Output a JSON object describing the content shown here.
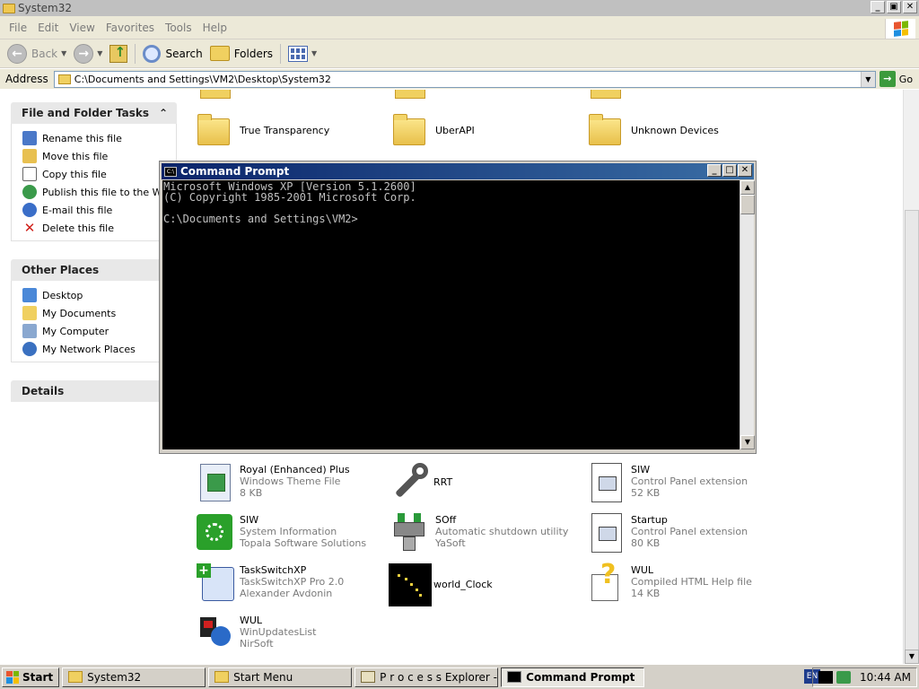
{
  "window": {
    "title": "System32",
    "buttons": {
      "minimize": "_",
      "maximize": "▣",
      "close": "✕"
    }
  },
  "menu": [
    "File",
    "Edit",
    "View",
    "Favorites",
    "Tools",
    "Help"
  ],
  "toolbar": {
    "back_label": "Back",
    "search_label": "Search",
    "folders_label": "Folders"
  },
  "address": {
    "label": "Address",
    "value": "C:\\Documents and Settings\\VM2\\Desktop\\System32",
    "go_label": "Go"
  },
  "left_pane": {
    "file_tasks": {
      "title": "File and Folder Tasks",
      "items": [
        {
          "label": "Rename this file",
          "icon": "rename-icon"
        },
        {
          "label": "Move this file",
          "icon": "move-icon"
        },
        {
          "label": "Copy this file",
          "icon": "copy-icon"
        },
        {
          "label": "Publish this file to the Web",
          "icon": "publish-icon"
        },
        {
          "label": "E-mail this file",
          "icon": "email-icon"
        },
        {
          "label": "Delete this file",
          "icon": "delete-icon"
        }
      ]
    },
    "other_places": {
      "title": "Other Places",
      "items": [
        {
          "label": "Desktop",
          "icon": "desktop-icon"
        },
        {
          "label": "My Documents",
          "icon": "documents-icon"
        },
        {
          "label": "My Computer",
          "icon": "computer-icon"
        },
        {
          "label": "My Network Places",
          "icon": "network-icon"
        }
      ]
    },
    "details": {
      "title": "Details"
    }
  },
  "files_top": [
    {
      "name": "True Transparency",
      "icon": "folder-icon"
    },
    {
      "name": "UberAPI",
      "icon": "folder-icon"
    },
    {
      "name": "Unknown Devices",
      "icon": "folder-icon"
    }
  ],
  "files": [
    {
      "name": "Royal (Enhanced) Plus",
      "line2": "Windows Theme File",
      "line3": "8 KB",
      "icon": "theme-file-icon"
    },
    {
      "name": "RRT",
      "line2": "",
      "line3": "",
      "icon": "wrench-icon"
    },
    {
      "name": "SIW",
      "line2": "Control Panel extension",
      "line3": "52 KB",
      "icon": "control-panel-icon"
    },
    {
      "name": "SIW",
      "line2": "System Information",
      "line3": "Topala Software Solutions",
      "icon": "siw-icon"
    },
    {
      "name": "SOff",
      "line2": "Automatic shutdown utility",
      "line3": "YaSoft",
      "icon": "plug-icon"
    },
    {
      "name": "Startup",
      "line2": "Control Panel extension",
      "line3": "80 KB",
      "icon": "control-panel-icon"
    },
    {
      "name": "TaskSwitchXP",
      "line2": "TaskSwitchXP Pro 2.0",
      "line3": "Alexander Avdonin",
      "icon": "taskswitch-icon"
    },
    {
      "name": "world_Clock",
      "line2": "",
      "line3": "",
      "icon": "world-clock-icon"
    },
    {
      "name": "WUL",
      "line2": "Compiled HTML Help file",
      "line3": "14 KB",
      "icon": "help-file-icon"
    },
    {
      "name": "WUL",
      "line2": "WinUpdatesList",
      "line3": "NirSoft",
      "icon": "wul-icon"
    }
  ],
  "cmd": {
    "title": "Command Prompt",
    "lines": [
      "Microsoft Windows XP [Version 5.1.2600]",
      "(C) Copyright 1985-2001 Microsoft Corp.",
      "",
      "C:\\Documents and Settings\\VM2>"
    ]
  },
  "taskbar": {
    "start_label": "Start",
    "tasks": [
      {
        "label": "System32",
        "icon": "folder-icon",
        "active": false
      },
      {
        "label": "Start Menu",
        "icon": "folder-icon",
        "active": false
      },
      {
        "label": "P r o c e s s  Explorer - W...",
        "icon": "process-explorer-icon",
        "active": false
      },
      {
        "label": "Command Prompt",
        "icon": "cmd-icon",
        "active": true
      }
    ],
    "language": "EN",
    "clock": "10:44 AM"
  },
  "colors": {
    "title_bar_active": "#0a246a",
    "xp_blue": "#3a6ea5",
    "go_green": "#3c9a3c"
  }
}
